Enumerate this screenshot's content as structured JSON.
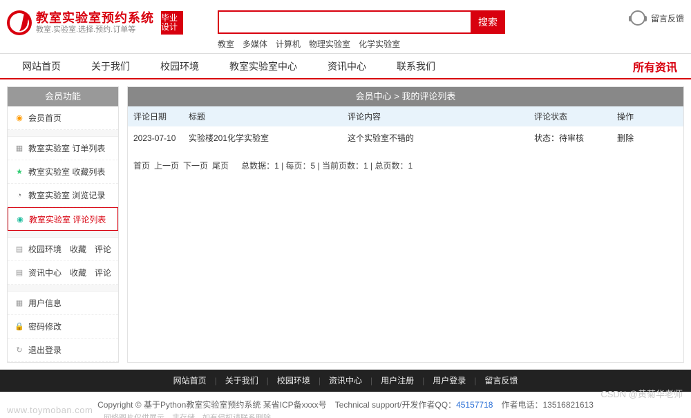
{
  "header": {
    "title": "教室实验室预约系统",
    "subtitle": "教室.实验室.选择.预约.订单等",
    "badge": "毕业设计",
    "search_button": "搜索",
    "search_tags": [
      "教室",
      "多媒体",
      "计算机",
      "物理实验室",
      "化学实验室"
    ],
    "feedback": "留言反馈"
  },
  "nav": {
    "items": [
      "网站首页",
      "关于我们",
      "校园环境",
      "教室实验室中心",
      "资讯中心",
      "联系我们"
    ],
    "right": "所有资讯"
  },
  "sidebar": {
    "title": "会员功能",
    "groups": [
      [
        {
          "ico": "home",
          "label": "会员首页"
        }
      ],
      [
        {
          "ico": "grid",
          "label": "教室实验室 订单列表"
        },
        {
          "ico": "star",
          "label": "教室实验室 收藏列表"
        },
        {
          "ico": "clock",
          "label": "教室实验室 浏览记录"
        },
        {
          "ico": "dot",
          "label": "教室实验室 评论列表",
          "active": true
        }
      ],
      [
        {
          "ico": "box",
          "label": "校园环境　收藏　评论"
        },
        {
          "ico": "box",
          "label": "资讯中心　收藏　评论"
        }
      ],
      [
        {
          "ico": "grid",
          "label": "用户信息"
        },
        {
          "ico": "lock",
          "label": "密码修改"
        },
        {
          "ico": "out",
          "label": "退出登录"
        }
      ]
    ]
  },
  "main": {
    "crumb": "会员中心 > 我的评论列表",
    "columns": [
      "评论日期",
      "标题",
      "评论内容",
      "评论状态",
      "操作"
    ],
    "rows": [
      {
        "date": "2023-07-10",
        "title": "实验楼201化学实验室",
        "content": "这个实验室不错的",
        "status": "状态：待审核",
        "op": "删除"
      }
    ],
    "pager": {
      "links": [
        "首页",
        "上一页",
        "下一页",
        "尾页"
      ],
      "stats": "总数据：1 | 每页：5 | 当前页数：1 | 总页数：1"
    }
  },
  "footer": {
    "links": [
      "网站首页",
      "关于我们",
      "校园环境",
      "资讯中心",
      "用户注册",
      "用户登录",
      "留言反馈"
    ],
    "copyright_prefix": "Copyright © 基于Python教室实验室预约系统 某省ICP备xxxx号　Technical support/开发作者QQ：",
    "qq": "45157718",
    "author_phone_label": "　作者电话：",
    "author_phone": "13516821613"
  },
  "watermark": {
    "left": "www.toymoban.com",
    "note": "网络图片仅供展示，非存储，如有侵权请联系删除。",
    "right": "CSDN @黄菊华老师"
  },
  "icons": {
    "home": "◉",
    "grid": "▦",
    "star": "★",
    "clock": "◔",
    "dot": "◉",
    "box": "▤",
    "lock": "🔒",
    "out": "↻"
  }
}
